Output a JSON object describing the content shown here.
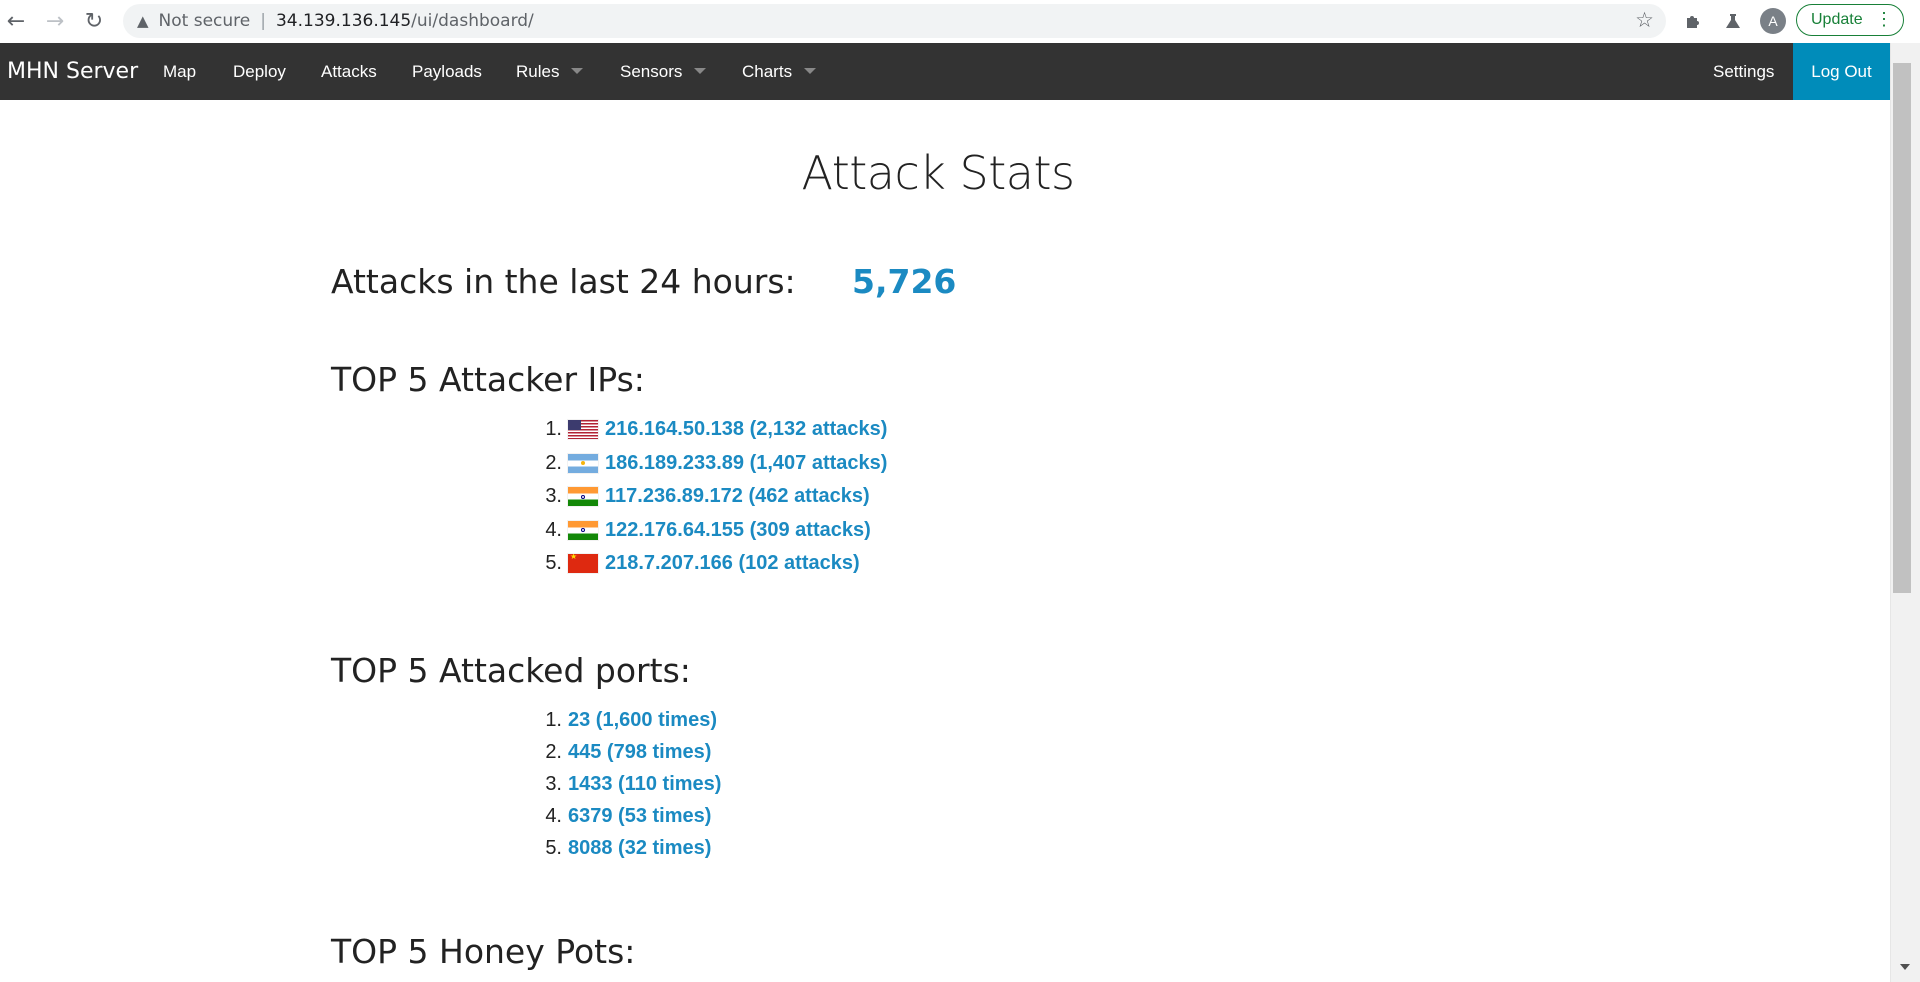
{
  "browser": {
    "omnibox": {
      "security_label": "Not secure",
      "separator": "|",
      "host": "34.139.136.145",
      "path": "/ui/dashboard/"
    },
    "profile_initial": "A",
    "update_label": "Update"
  },
  "navbar": {
    "brand": "MHN Server",
    "items": [
      {
        "label": "Map"
      },
      {
        "label": "Deploy"
      },
      {
        "label": "Attacks"
      },
      {
        "label": "Payloads"
      },
      {
        "label": "Rules",
        "dropdown": true
      },
      {
        "label": "Sensors",
        "dropdown": true
      },
      {
        "label": "Charts",
        "dropdown": true
      }
    ],
    "settings": "Settings",
    "logout": "Log Out",
    "logout_color": "#008cba",
    "bar_color": "#333333"
  },
  "page": {
    "title": "Attack Stats",
    "attacks_24h_label": "Attacks in the last 24 hours:",
    "attacks_24h_value": "5,726",
    "top_ips_heading": "TOP 5 Attacker IPs:",
    "top_ips": [
      {
        "num": "1.",
        "flag": "us-flag-icon",
        "text": "216.164.50.138 (2,132 attacks)"
      },
      {
        "num": "2.",
        "flag": "ar-flag-icon",
        "text": "186.189.233.89 (1,407 attacks)"
      },
      {
        "num": "3.",
        "flag": "in-flag-icon",
        "text": "117.236.89.172 (462 attacks)"
      },
      {
        "num": "4.",
        "flag": "in-flag-icon",
        "text": "122.176.64.155 (309 attacks)"
      },
      {
        "num": "5.",
        "flag": "cn-flag-icon",
        "text": "218.7.207.166 (102 attacks)"
      }
    ],
    "top_ports_heading": "TOP 5 Attacked ports:",
    "top_ports": [
      {
        "num": "1.",
        "text": "23 (1,600 times)"
      },
      {
        "num": "2.",
        "text": "445 (798 times)"
      },
      {
        "num": "3.",
        "text": "1433 (110 times)"
      },
      {
        "num": "4.",
        "text": "6379 (53 times)"
      },
      {
        "num": "5.",
        "text": "8088 (32 times)"
      }
    ],
    "top_honeypots_heading": "TOP 5 Honey Pots:",
    "link_color": "#1b8ac2"
  }
}
